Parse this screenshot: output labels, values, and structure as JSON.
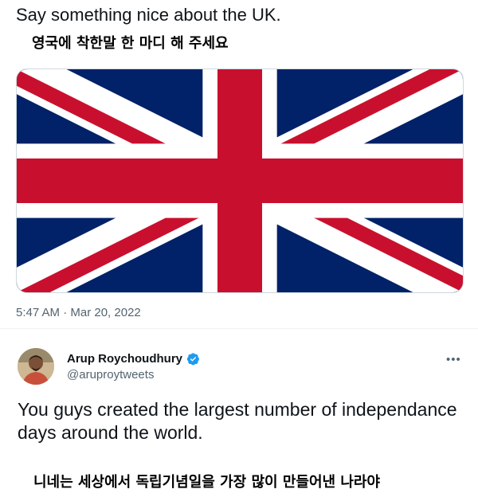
{
  "tweet": {
    "text": "Say something nice about the UK.",
    "caption_ko": "영국에 착한말 한 마디 해 주세요",
    "timestamp": "5:47 AM · Mar 20, 2022",
    "image": {
      "icon": "union-jack-flag"
    }
  },
  "reply": {
    "author_name": "Arup Roychoudhury",
    "handle": "@aruproytweets",
    "verified_icon": "verified-badge-icon",
    "more_icon": "more-options-icon",
    "text": "You guys created the largest number of independance days around the world.",
    "caption_ko": "니네는 세상에서 독립기념일을 가장 많이 만들어낸 나라야"
  },
  "colors": {
    "flag_blue": "#012169",
    "flag_red": "#C8102E",
    "verified_blue": "#1d9bf0",
    "secondary_text": "#536471"
  }
}
